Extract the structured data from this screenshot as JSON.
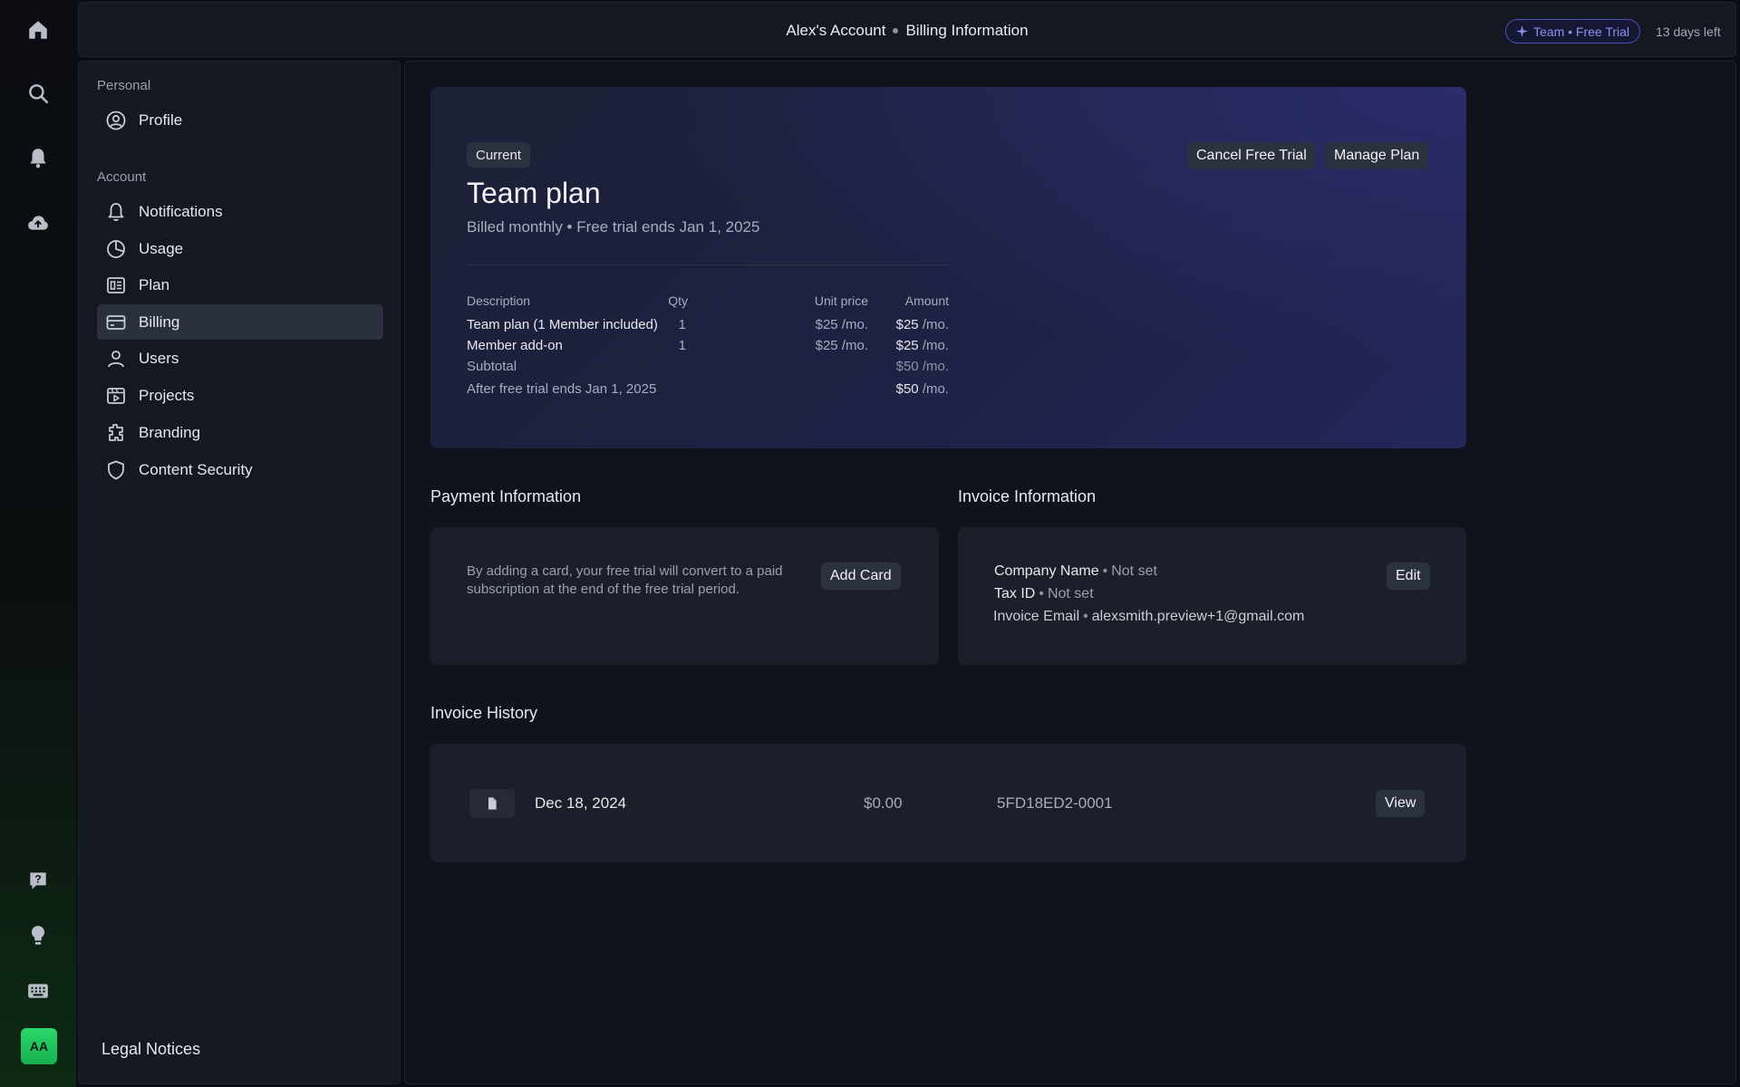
{
  "header": {
    "account": "Alex's Account",
    "page": "Billing Information",
    "trial_badge": "Team • Free Trial",
    "days_left": "13 days left"
  },
  "rail": {
    "icons": [
      "home-icon",
      "search-icon",
      "bell-icon",
      "cloud-upload-icon",
      "help-icon",
      "lightbulb-icon",
      "keyboard-icon"
    ],
    "avatar_initials": "AA"
  },
  "sidebar": {
    "personal_label": "Personal",
    "account_label": "Account",
    "items": [
      {
        "label": "Profile",
        "icon": "profile-icon"
      },
      {
        "label": "Notifications",
        "icon": "bell-icon"
      },
      {
        "label": "Usage",
        "icon": "pie-chart-icon"
      },
      {
        "label": "Plan",
        "icon": "plan-icon"
      },
      {
        "label": "Billing",
        "icon": "credit-card-icon",
        "active": true
      },
      {
        "label": "Users",
        "icon": "user-icon"
      },
      {
        "label": "Projects",
        "icon": "projects-icon"
      },
      {
        "label": "Branding",
        "icon": "branding-icon"
      },
      {
        "label": "Content Security",
        "icon": "shield-icon"
      }
    ],
    "legal": "Legal Notices"
  },
  "plan": {
    "status_chip": "Current",
    "cancel_label": "Cancel Free Trial",
    "manage_label": "Manage Plan",
    "title": "Team plan",
    "subtitle": "Billed monthly • Free trial ends Jan 1, 2025",
    "table": {
      "headers": {
        "description": "Description",
        "qty": "Qty",
        "unit_price": "Unit price",
        "amount": "Amount"
      },
      "rows": [
        {
          "description": "Team plan (1 Member included)",
          "qty": "1",
          "unit_price": "$25",
          "unit_suffix": "/mo.",
          "amount": "$25",
          "amount_suffix": "/mo."
        },
        {
          "description": "Member add-on",
          "qty": "1",
          "unit_price": "$25",
          "unit_suffix": "/mo.",
          "amount": "$25",
          "amount_suffix": "/mo."
        }
      ],
      "subtotal": {
        "label": "Subtotal",
        "amount": "$50",
        "suffix": "/mo."
      },
      "after_trial": {
        "label": "After free trial ends Jan 1, 2025",
        "amount": "$50",
        "suffix": "/mo."
      }
    }
  },
  "payment": {
    "title": "Payment Information",
    "message": "By adding a card, your free trial will convert to a paid subscription at the end of the free trial period.",
    "add_card_label": "Add Card"
  },
  "invoice_info": {
    "title": "Invoice Information",
    "edit_label": "Edit",
    "company_label": "Company Name",
    "company_value": "Not set",
    "tax_label": "Tax ID",
    "tax_value": "Not set",
    "email_label": "Invoice Email",
    "email_value": "alexsmith.preview+1@gmail.com"
  },
  "history": {
    "title": "Invoice History",
    "rows": [
      {
        "date": "Dec 18, 2024",
        "amount": "$0.00",
        "number": "5FD18ED2-0001",
        "view_label": "View"
      }
    ]
  }
}
